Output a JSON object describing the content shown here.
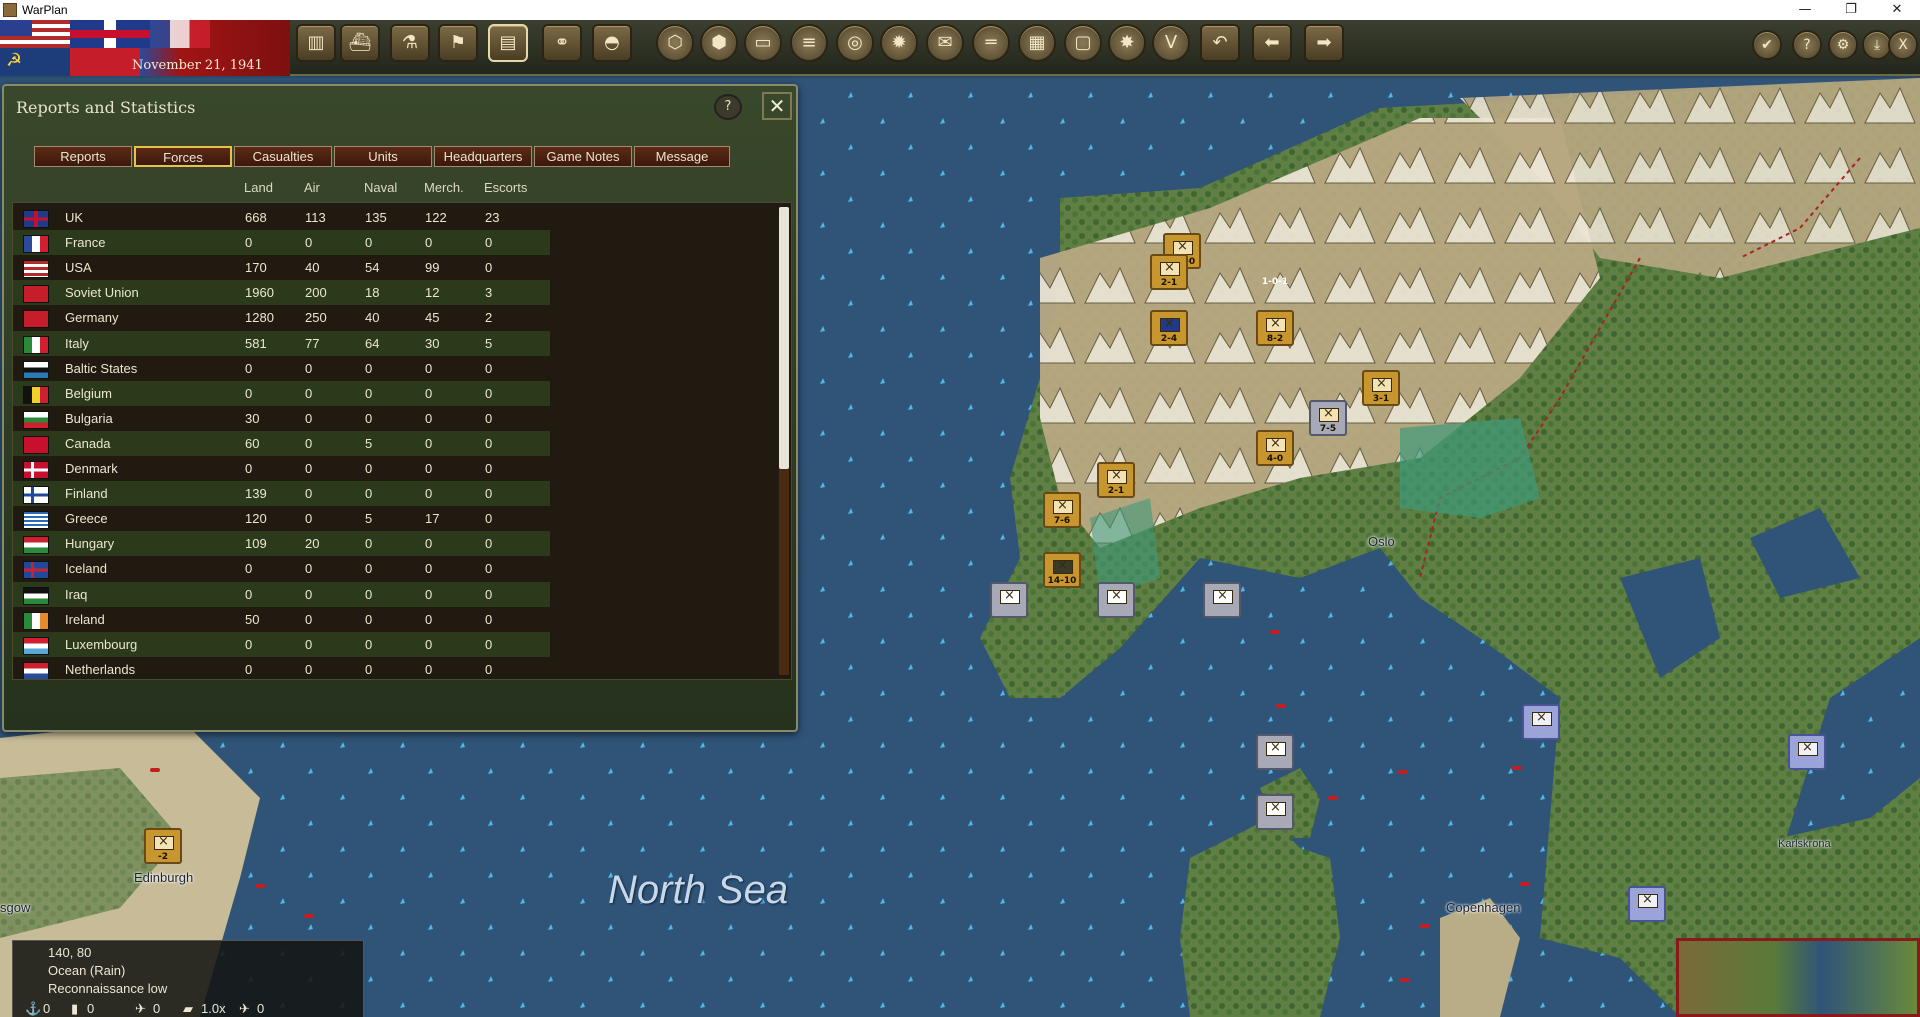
{
  "window": {
    "title": "WarPlan",
    "minimize": "—",
    "restore": "❐",
    "close": "✕"
  },
  "topbar": {
    "date": "November 21, 1941",
    "buttons": [
      {
        "name": "production-button",
        "glyph": "▥"
      },
      {
        "name": "shipyard-button",
        "glyph": "⛴"
      },
      {
        "name": "research-button",
        "glyph": "⚗"
      },
      {
        "name": "flag-button",
        "glyph": "⚑"
      },
      {
        "name": "reports-button",
        "glyph": "▤"
      },
      {
        "name": "recon-button",
        "glyph": "⚭"
      },
      {
        "name": "helmet-button",
        "glyph": "◓"
      },
      {
        "name": "hex-filter-button",
        "glyph": "⬡"
      },
      {
        "name": "hex-grid-button",
        "glyph": "⬢"
      },
      {
        "name": "tank-filter-button",
        "glyph": "▭"
      },
      {
        "name": "supply-filter-button",
        "glyph": "≡"
      },
      {
        "name": "target-button",
        "glyph": "◎"
      },
      {
        "name": "resource-button",
        "glyph": "✹"
      },
      {
        "name": "mail-button",
        "glyph": "✉"
      },
      {
        "name": "rail-button",
        "glyph": "═"
      },
      {
        "name": "grid-button",
        "glyph": "▦"
      },
      {
        "name": "frame-button",
        "glyph": "▢"
      },
      {
        "name": "explosion-button",
        "glyph": "✸"
      },
      {
        "name": "victory-button",
        "glyph": "V"
      },
      {
        "name": "undo-button",
        "glyph": "↶"
      },
      {
        "name": "back-button",
        "glyph": "⬅"
      },
      {
        "name": "forward-button",
        "glyph": "➡"
      }
    ],
    "right_buttons": [
      {
        "name": "end-turn-button",
        "glyph": "✔"
      },
      {
        "name": "help-button",
        "glyph": "?"
      },
      {
        "name": "settings-button",
        "glyph": "⚙"
      },
      {
        "name": "save-button",
        "glyph": "⤓"
      },
      {
        "name": "exit-button",
        "glyph": "X"
      }
    ]
  },
  "dialog": {
    "title": "Reports and Statistics",
    "help": "?",
    "close": "✕",
    "tabs": [
      "Reports",
      "Forces",
      "Casualties",
      "Units",
      "Headquarters",
      "Game Notes",
      "Message"
    ],
    "active_tab": "Forces",
    "columns": [
      "Land",
      "Air",
      "Naval",
      "Merch.",
      "Escorts"
    ],
    "rows": [
      {
        "country": "UK",
        "land": "668",
        "air": "113",
        "naval": "135",
        "merch": "122",
        "escorts": "23"
      },
      {
        "country": "France",
        "land": "0",
        "air": "0",
        "naval": "0",
        "merch": "0",
        "escorts": "0"
      },
      {
        "country": "USA",
        "land": "170",
        "air": "40",
        "naval": "54",
        "merch": "99",
        "escorts": "0"
      },
      {
        "country": "Soviet Union",
        "land": "1960",
        "air": "200",
        "naval": "18",
        "merch": "12",
        "escorts": "3"
      },
      {
        "country": "Germany",
        "land": "1280",
        "air": "250",
        "naval": "40",
        "merch": "45",
        "escorts": "2"
      },
      {
        "country": "Italy",
        "land": "581",
        "air": "77",
        "naval": "64",
        "merch": "30",
        "escorts": "5"
      },
      {
        "country": "Baltic States",
        "land": "0",
        "air": "0",
        "naval": "0",
        "merch": "0",
        "escorts": "0"
      },
      {
        "country": "Belgium",
        "land": "0",
        "air": "0",
        "naval": "0",
        "merch": "0",
        "escorts": "0"
      },
      {
        "country": "Bulgaria",
        "land": "30",
        "air": "0",
        "naval": "0",
        "merch": "0",
        "escorts": "0"
      },
      {
        "country": "Canada",
        "land": "60",
        "air": "0",
        "naval": "5",
        "merch": "0",
        "escorts": "0"
      },
      {
        "country": "Denmark",
        "land": "0",
        "air": "0",
        "naval": "0",
        "merch": "0",
        "escorts": "0"
      },
      {
        "country": "Finland",
        "land": "139",
        "air": "0",
        "naval": "0",
        "merch": "0",
        "escorts": "0"
      },
      {
        "country": "Greece",
        "land": "120",
        "air": "0",
        "naval": "5",
        "merch": "17",
        "escorts": "0"
      },
      {
        "country": "Hungary",
        "land": "109",
        "air": "20",
        "naval": "0",
        "merch": "0",
        "escorts": "0"
      },
      {
        "country": "Iceland",
        "land": "0",
        "air": "0",
        "naval": "0",
        "merch": "0",
        "escorts": "0"
      },
      {
        "country": "Iraq",
        "land": "0",
        "air": "0",
        "naval": "0",
        "merch": "0",
        "escorts": "0"
      },
      {
        "country": "Ireland",
        "land": "50",
        "air": "0",
        "naval": "0",
        "merch": "0",
        "escorts": "0"
      },
      {
        "country": "Luxembourg",
        "land": "0",
        "air": "0",
        "naval": "0",
        "merch": "0",
        "escorts": "0"
      },
      {
        "country": "Netherlands",
        "land": "0",
        "air": "0",
        "naval": "0",
        "merch": "0",
        "escorts": "0"
      }
    ]
  },
  "map": {
    "sea_label": "North Sea",
    "cities": [
      "Edinburgh",
      "sgow",
      "Oslo",
      "Copenhagen",
      "Karlskrona"
    ],
    "units": [
      "1-1-0",
      "1-0-1",
      "2-1",
      "2-4",
      "8-2",
      "3-1",
      "7-5",
      "4-0",
      "2-1",
      "7-6",
      "14-10",
      "-2"
    ]
  },
  "info": {
    "coords": "140, 80",
    "terrain": "Ocean (Rain)",
    "recon": "Reconnaissance low",
    "stats": [
      "0",
      "0",
      "0",
      "1.0x",
      "0"
    ]
  },
  "colors": {
    "dialog_bg": "#2f3d23",
    "tab_active_border": "#e6c24a",
    "sea": "#2f5478"
  }
}
